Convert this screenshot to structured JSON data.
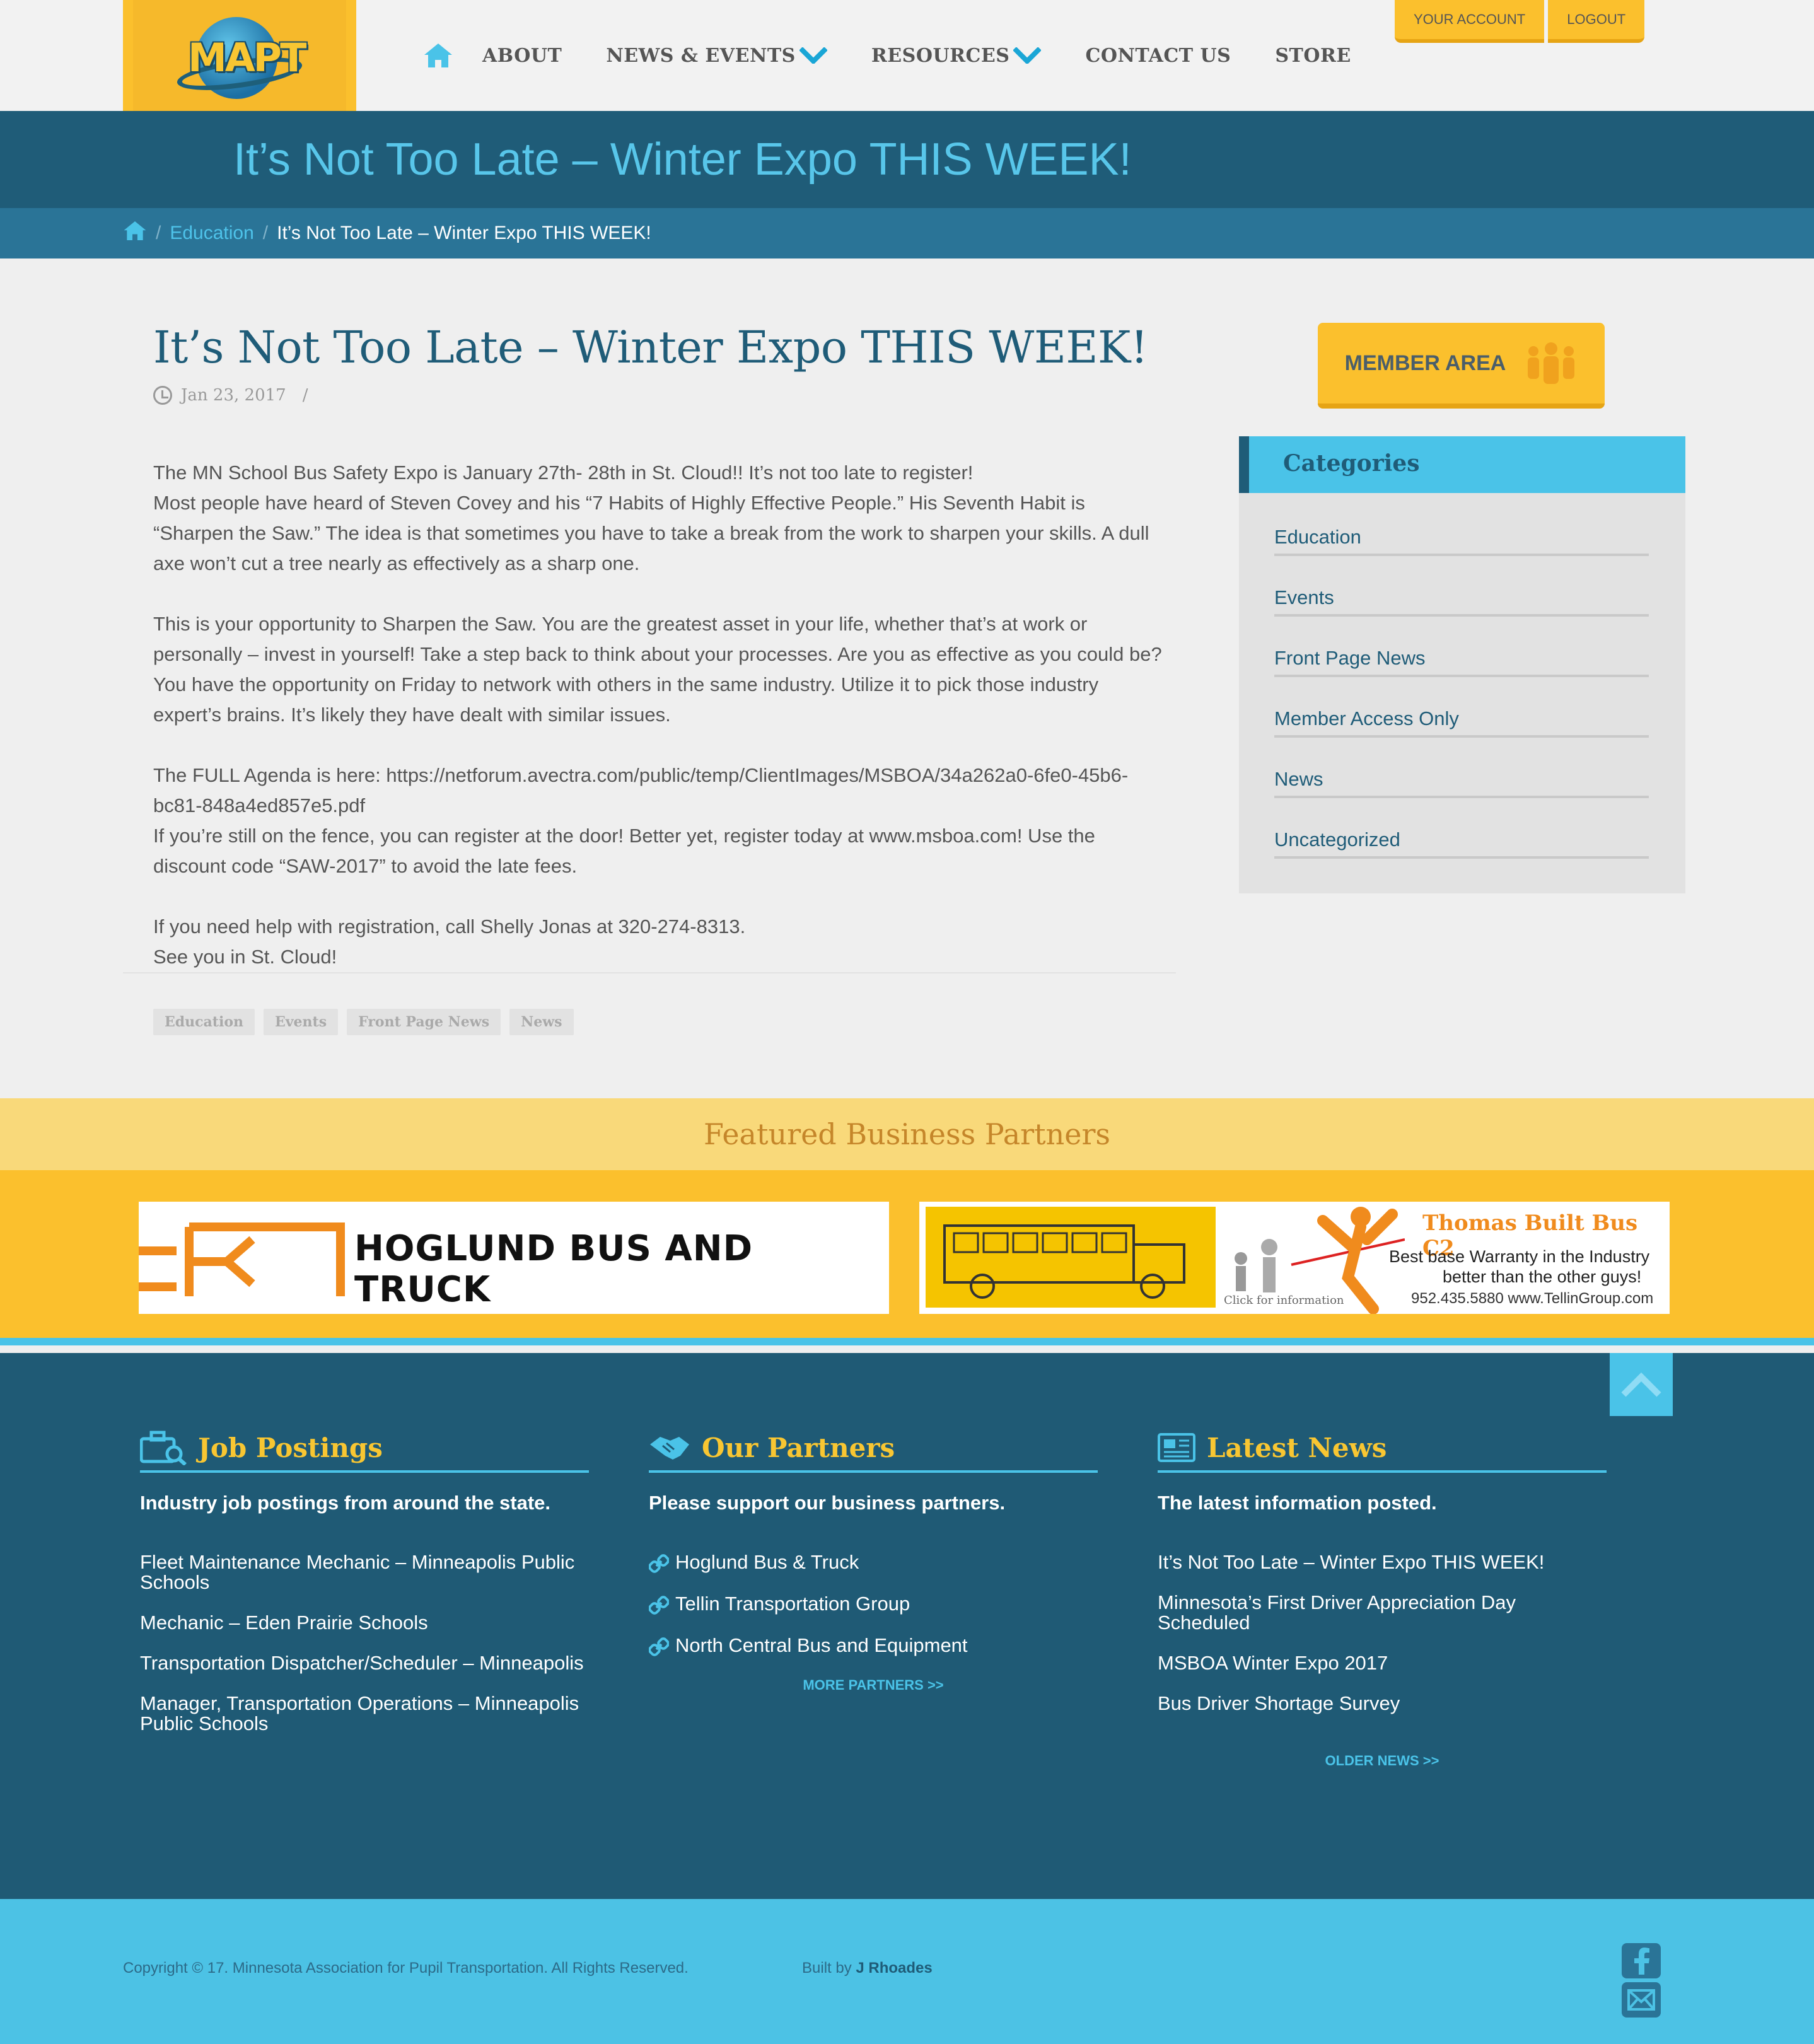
{
  "header": {
    "logo_text": "MAPT",
    "nav": [
      {
        "label": "ABOUT",
        "has_dropdown": false
      },
      {
        "label": "NEWS & EVENTS",
        "has_dropdown": true
      },
      {
        "label": "RESOURCES",
        "has_dropdown": true
      },
      {
        "label": "CONTACT US",
        "has_dropdown": false
      },
      {
        "label": "STORE",
        "has_dropdown": false
      }
    ],
    "account_label": "YOUR ACCOUNT",
    "logout_label": "LOGOUT"
  },
  "title_bar": {
    "title": "It’s Not Too Late – Winter Expo THIS WEEK!"
  },
  "breadcrumb": {
    "sep": "/",
    "parent": "Education",
    "current": "It’s Not Too Late – Winter Expo THIS WEEK!"
  },
  "article": {
    "title": "It’s Not Too Late – Winter Expo THIS WEEK!",
    "date": "Jan 23, 2017",
    "meta_sep": "/",
    "paragraphs": [
      "The MN School Bus Safety Expo is January 27th- 28th in St. Cloud!! It’s not too late to register!\nMost people have heard of Steven Covey and his “7 Habits of Highly Effective People.” His Seventh Habit is “Sharpen the Saw.” The idea is that sometimes you have to take a break from the work to sharpen your skills. A dull axe won’t cut a tree nearly as effectively as a sharp one.",
      "This is your opportunity to Sharpen the Saw. You are the greatest asset in your life, whether that’s at work or personally – invest in yourself! Take a step back to think about your processes. Are you as effective as you could be? You have the opportunity on Friday to network with others in the same industry. Utilize it to pick those industry expert’s brains. It’s likely they have dealt with similar issues.",
      "The FULL Agenda is here: https://netforum.avectra.com/public/temp/ClientImages/MSBOA/34a262a0-6fe0-45b6-bc81-848a4ed857e5.pdf\nIf you’re still on the fence, you can register at the door! Better yet, register today at www.msboa.com! Use the discount code “SAW-2017” to avoid the late fees.",
      "If you need help with registration, call Shelly Jonas at 320-274-8313.\nSee you in St. Cloud!"
    ],
    "tags": [
      "Education",
      "Events",
      "Front Page News",
      "News"
    ]
  },
  "sidebar": {
    "member_area_label": "MEMBER AREA",
    "categories_title": "Categories",
    "categories": [
      "Education",
      "Events",
      "Front Page News",
      "Member Access Only",
      "News",
      "Uncategorized"
    ]
  },
  "featured": {
    "title": "Featured Business Partners",
    "banner1_text": "HOGLUND BUS AND TRUCK",
    "banner2": {
      "title": "Thomas Built Bus C2",
      "line1": "Best base Warranty in the Industry",
      "line2": "better than the other guys!",
      "click": "Click for information",
      "url": "952.435.5880  www.TellinGroup.com"
    }
  },
  "footer": {
    "jobs": {
      "title": "Job Postings",
      "subtitle": "Industry job postings from around the state.",
      "items": [
        "Fleet Maintenance Mechanic – Minneapolis Public Schools",
        "Mechanic – Eden Prairie Schools",
        "Transportation Dispatcher/Scheduler – Minneapolis",
        "Manager, Transportation Operations – Minneapolis Public Schools"
      ]
    },
    "partners": {
      "title": "Our Partners",
      "subtitle": "Please support our business partners.",
      "items": [
        "Hoglund Bus & Truck",
        "Tellin Transportation Group",
        "North Central Bus and Equipment"
      ],
      "more": "MORE PARTNERS >>"
    },
    "news": {
      "title": "Latest News",
      "subtitle": "The latest information posted.",
      "items": [
        "It’s Not Too Late – Winter Expo THIS WEEK!",
        "Minnesota’s First Driver Appreciation Day Scheduled",
        "MSBOA Winter Expo 2017",
        "Bus Driver Shortage Survey"
      ],
      "more": "OLDER NEWS >>"
    }
  },
  "bottom": {
    "copyright": "Copyright © 17. Minnesota Association for Pupil Transportation. All Rights Reserved.",
    "built_by_prefix": "Built by",
    "built_by_name": "J Rhoades"
  },
  "colors": {
    "brand_yellow": "#fbc02d",
    "brand_dark_blue": "#1f5c78",
    "brand_light_blue": "#4ac3e8"
  }
}
